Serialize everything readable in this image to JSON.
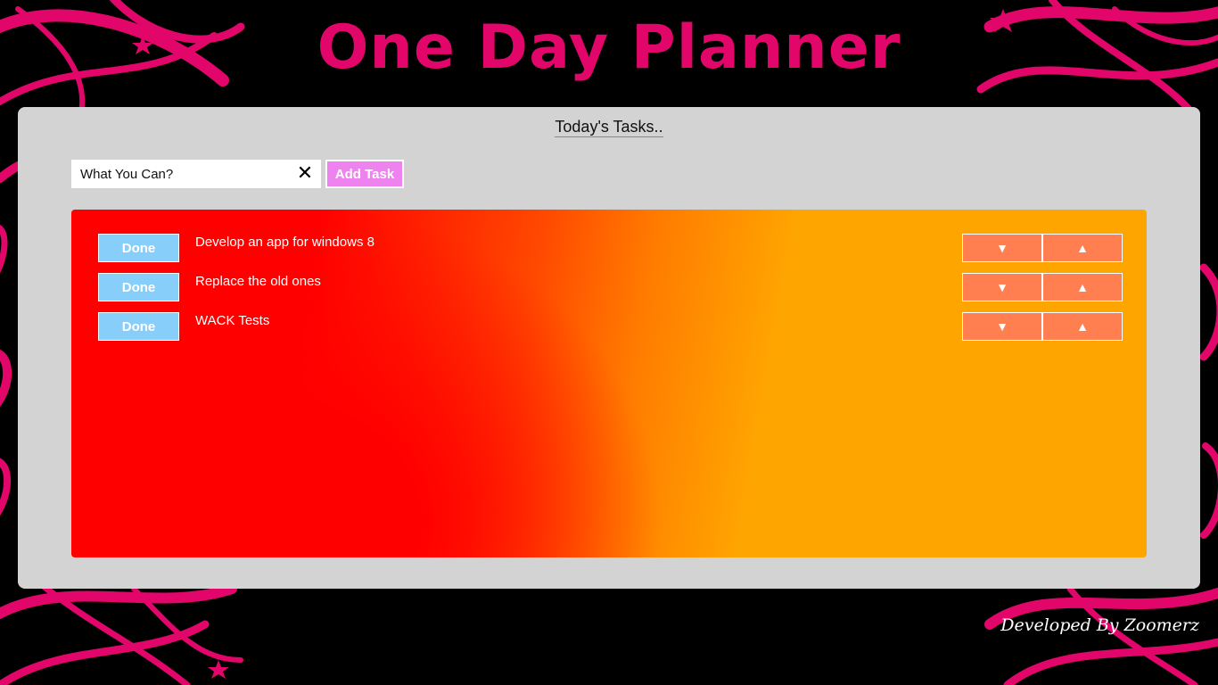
{
  "app": {
    "title": "One Day Planner",
    "accent_color": "#e2066a"
  },
  "panel": {
    "heading": "Today's Tasks..",
    "input": {
      "value": "What You Can?",
      "clear_icon": "close-icon"
    },
    "add_button_label": "Add Task"
  },
  "tasks": [
    {
      "done_label": "Done",
      "text": "Develop an app for windows 8",
      "down_icon": "▼",
      "up_icon": "▲"
    },
    {
      "done_label": "Done",
      "text": "Replace the old ones",
      "down_icon": "▼",
      "up_icon": "▲"
    },
    {
      "done_label": "Done",
      "text": "WACK Tests",
      "down_icon": "▼",
      "up_icon": "▲"
    }
  ],
  "footer": {
    "credit": "Developed By Zoomerz"
  },
  "colors": {
    "panel_bg": "#d3d3d3",
    "add_button": "#ee82ee",
    "done_button": "#87cefa",
    "move_button": "#ff7f50",
    "gradient_start": "#ff0000",
    "gradient_end": "#ffa500"
  }
}
